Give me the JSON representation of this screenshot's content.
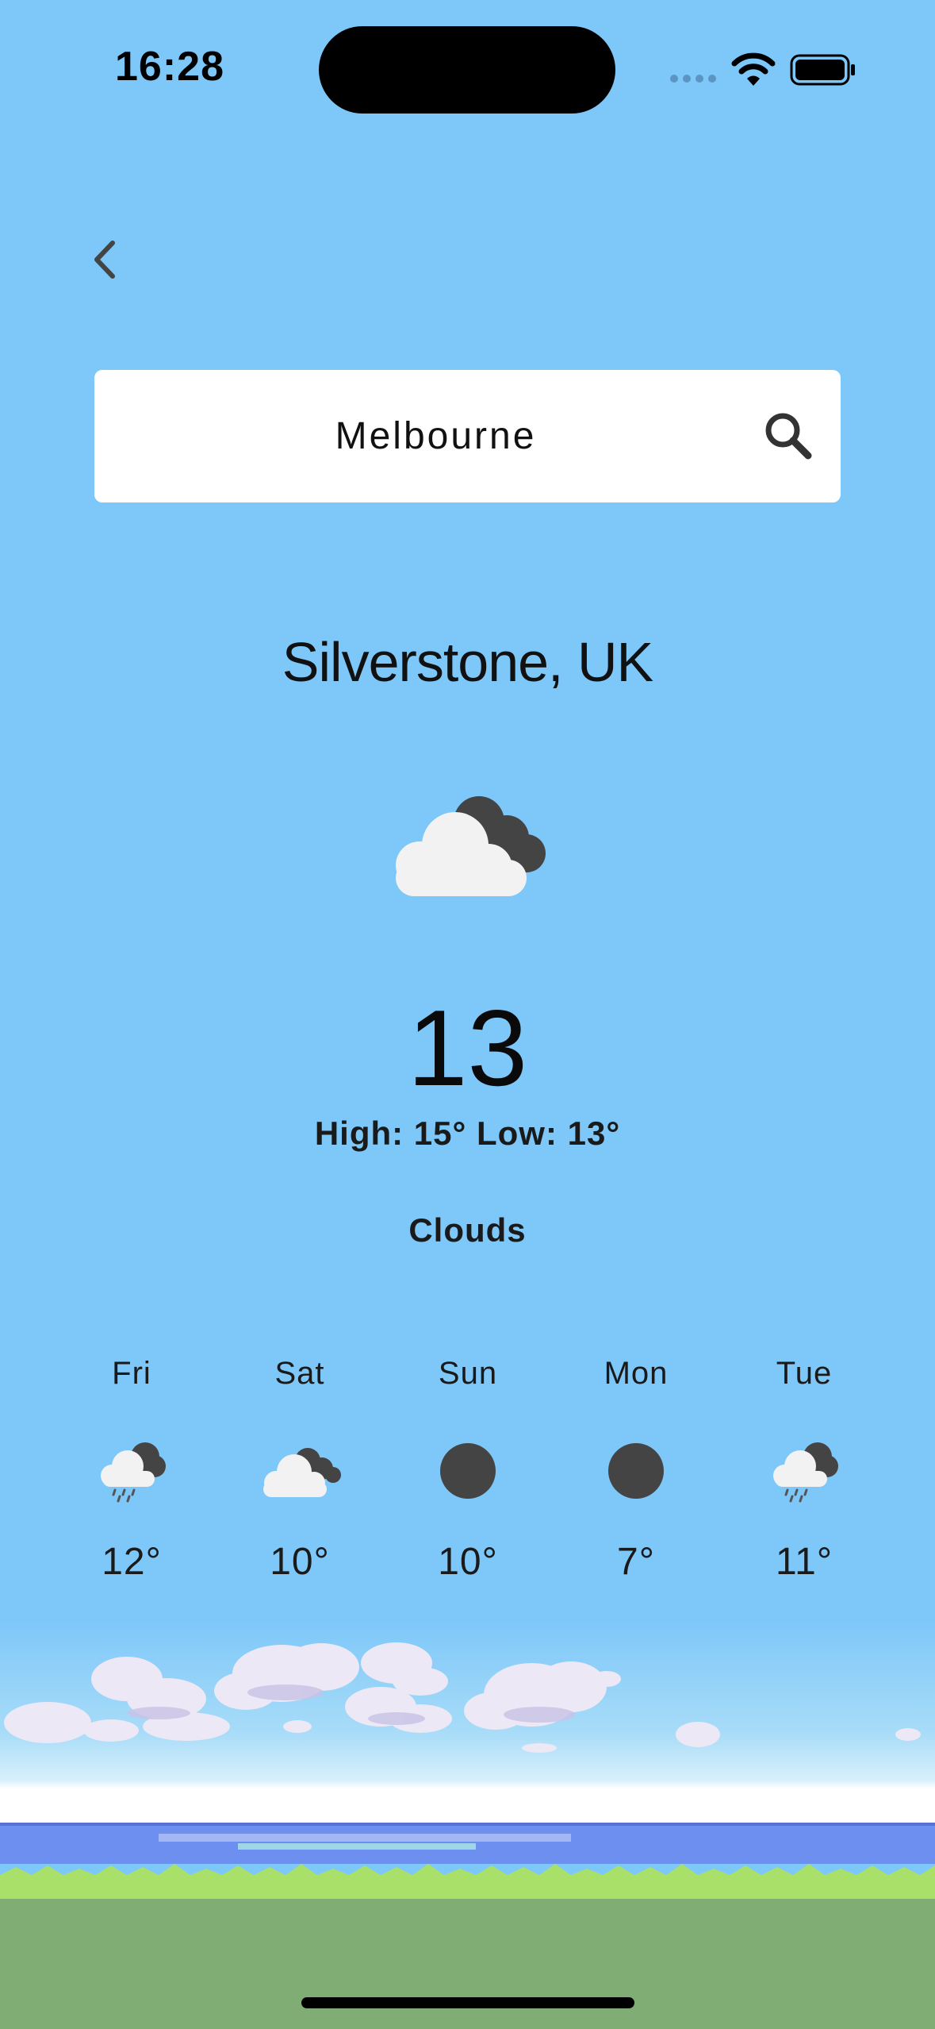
{
  "status_bar": {
    "time": "16:28"
  },
  "search": {
    "value": "Melbourne"
  },
  "current": {
    "city": "Silverstone, UK",
    "icon": "clouds-icon",
    "temperature": "13",
    "high_low": "High: 15° Low: 13°",
    "condition": "Clouds"
  },
  "forecast": [
    {
      "day": "Fri",
      "icon": "rain-clouds-icon",
      "temp": "12°"
    },
    {
      "day": "Sat",
      "icon": "clouds-icon",
      "temp": "10°"
    },
    {
      "day": "Sun",
      "icon": "dark-circle-icon",
      "temp": "10°"
    },
    {
      "day": "Mon",
      "icon": "dark-circle-icon",
      "temp": "7°"
    },
    {
      "day": "Tue",
      "icon": "rain-clouds-icon",
      "temp": "11°"
    }
  ],
  "colors": {
    "sky": "#7dc7f9",
    "cloud_light": "#f2f2f2",
    "cloud_dark": "#444444",
    "water": "#6d8ff0",
    "grass_light": "#a8e06a",
    "grass_dark": "#80ad73"
  }
}
